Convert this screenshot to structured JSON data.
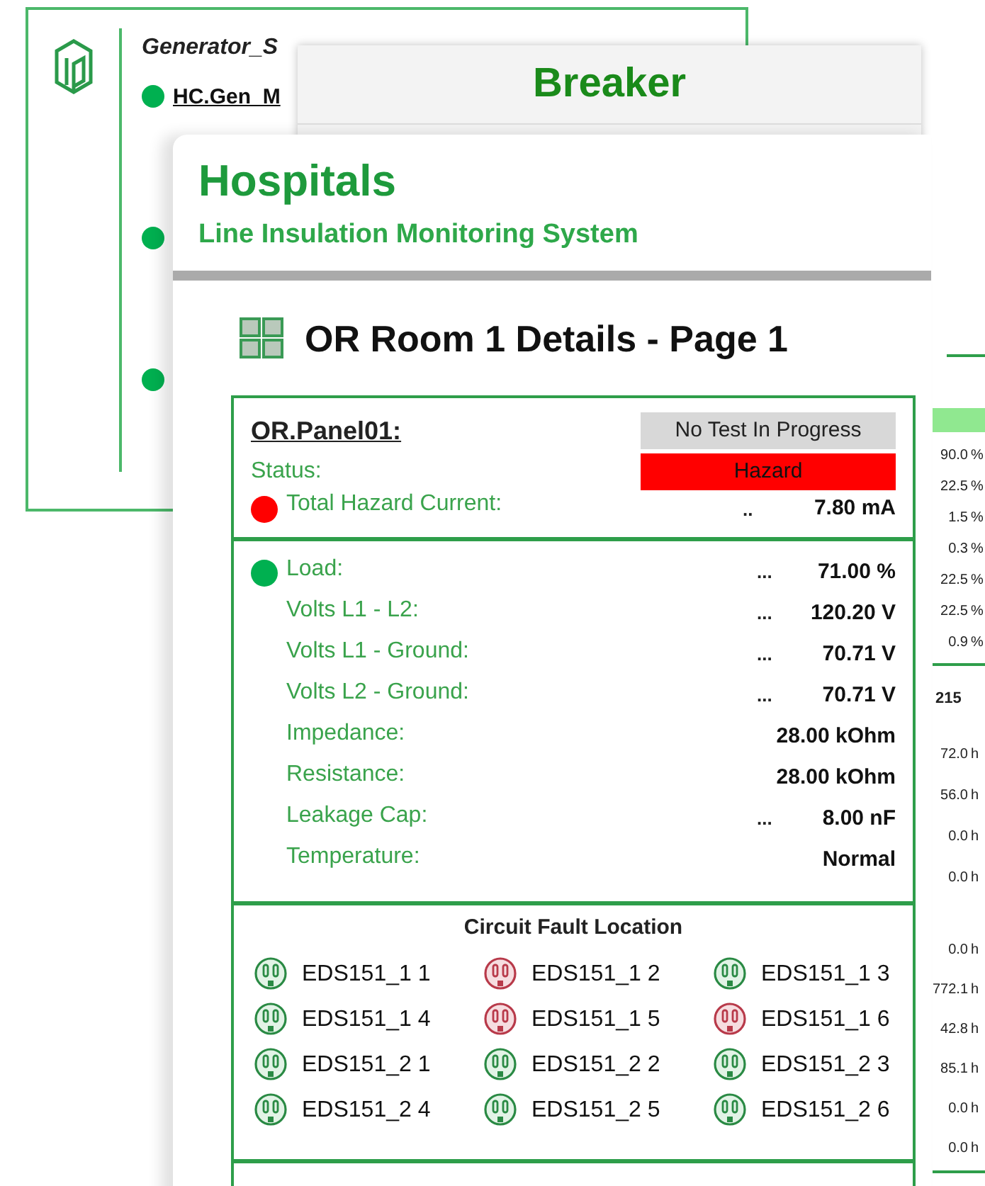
{
  "generator_window": {
    "title": "Generator_S",
    "link": "HC.Gen_M",
    "dots": [
      {
        "color": "#00b050"
      },
      {
        "color": "#00b050"
      },
      {
        "color": "#00b050"
      }
    ]
  },
  "breaker_window": {
    "title": "Breaker"
  },
  "side_window": {
    "top_rows": [
      {
        "value": "90.0",
        "unit": "%"
      },
      {
        "value": "22.5",
        "unit": "%"
      },
      {
        "value": "1.5",
        "unit": "%"
      },
      {
        "value": "0.3",
        "unit": "%"
      },
      {
        "value": "22.5",
        "unit": "%"
      },
      {
        "value": "22.5",
        "unit": "%"
      },
      {
        "value": "0.9",
        "unit": "%"
      }
    ],
    "total": "215",
    "bottom_rows": [
      {
        "value": "72.0",
        "unit": "h"
      },
      {
        "value": "56.0",
        "unit": "h"
      },
      {
        "value": "0.0",
        "unit": "h"
      },
      {
        "value": "0.0",
        "unit": "h"
      }
    ],
    "last_rows": [
      {
        "value": "0.0",
        "unit": "h"
      },
      {
        "value": "772.1",
        "unit": "h"
      },
      {
        "value": "42.8",
        "unit": "h"
      },
      {
        "value": "85.1",
        "unit": "h"
      },
      {
        "value": "0.0",
        "unit": "h"
      },
      {
        "value": "0.0",
        "unit": "h"
      }
    ]
  },
  "main_window": {
    "title": "Hospitals",
    "subtitle": "Line Insulation Monitoring System",
    "page_title": "OR Room 1 Details - Page 1",
    "panel": {
      "name": "OR.Panel01:",
      "test_status": "No Test In Progress",
      "status_label": "Status:",
      "status_value": "Hazard",
      "status_alarm": true,
      "hazard": {
        "label": "Total Hazard Current:",
        "dots": "..",
        "value": "7.80 mA",
        "color": "#ff0000"
      },
      "measurements": [
        {
          "label": "Load:",
          "dots": "...",
          "value": "71.00 %",
          "color": "#00b050"
        },
        {
          "label": "Volts L1 - L2:",
          "dots": "...",
          "value": "120.20 V"
        },
        {
          "label": "Volts L1 - Ground:",
          "dots": "...",
          "value": "70.71 V"
        },
        {
          "label": "Volts L2 - Ground:",
          "dots": "...",
          "value": "70.71 V"
        },
        {
          "label": "Impedance:",
          "value": "28.00 kOhm"
        },
        {
          "label": "Resistance:",
          "value": "28.00 kOhm"
        },
        {
          "label": "Leakage Cap:",
          "dots": "...",
          "value": "8.00 nF"
        },
        {
          "label": "Temperature:",
          "value": "Normal"
        }
      ],
      "fault_title": "Circuit Fault Location",
      "outlets": [
        {
          "label": "EDS151_1 1",
          "fault": false
        },
        {
          "label": "EDS151_1 2",
          "fault": true
        },
        {
          "label": "EDS151_1 3",
          "fault": false
        },
        {
          "label": "EDS151_1 4",
          "fault": false
        },
        {
          "label": "EDS151_1 5",
          "fault": true
        },
        {
          "label": "EDS151_1 6",
          "fault": true
        },
        {
          "label": "EDS151_2 1",
          "fault": false
        },
        {
          "label": "EDS151_2 2",
          "fault": false
        },
        {
          "label": "EDS151_2 3",
          "fault": false
        },
        {
          "label": "EDS151_2 4",
          "fault": false
        },
        {
          "label": "EDS151_2 5",
          "fault": false
        },
        {
          "label": "EDS151_2 6",
          "fault": false
        }
      ]
    }
  }
}
